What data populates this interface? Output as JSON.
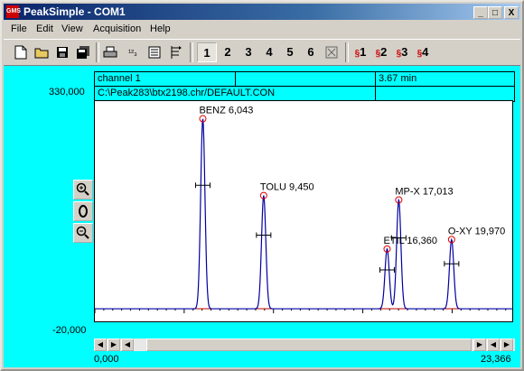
{
  "window": {
    "title": "PeakSimple - COM1",
    "app_icon_text": "GMS",
    "minimize": "_",
    "maximize": "□",
    "close": "X"
  },
  "menu": [
    {
      "label": "File"
    },
    {
      "label": "Edit"
    },
    {
      "label": "View"
    },
    {
      "label": "Acquisition"
    },
    {
      "label": "Help"
    }
  ],
  "toolbar": {
    "channels": [
      "1",
      "2",
      "3",
      "4",
      "5",
      "6"
    ],
    "multi_channels": [
      "1",
      "2",
      "3",
      "4"
    ],
    "sort_label": "¹²₃"
  },
  "header": {
    "channel": "channel 1",
    "time": "3.67 min",
    "path": "C:\\Peak283\\btx2198.chr/DEFAULT.CON"
  },
  "axes": {
    "y_max_label": "330,000",
    "y_min_label": "-20,000",
    "x_min_label": "0,000",
    "x_max_label": "23,366"
  },
  "chart_data": {
    "type": "line",
    "xlim": [
      0,
      23.366
    ],
    "ylim": [
      -20000,
      330000
    ],
    "grid": false,
    "peaks": [
      {
        "label": "BENZ 6,043",
        "name": "BENZ",
        "time": 6.043,
        "height": 302000
      },
      {
        "label": "TOLU 9,450",
        "name": "TOLU",
        "time": 9.45,
        "height": 180000
      },
      {
        "label": "ETIL 16,360",
        "name": "ETIL",
        "time": 16.36,
        "height": 95000
      },
      {
        "label": "MP-X 17,013",
        "name": "MP-X",
        "time": 17.013,
        "height": 173000
      },
      {
        "label": "O-XY 19,970",
        "name": "O-XY",
        "time": 19.97,
        "height": 110000
      }
    ]
  },
  "colors": {
    "background": "#00ffff",
    "trace": "#0000a0",
    "baseline": "#c00000",
    "marker": "#e00000"
  }
}
